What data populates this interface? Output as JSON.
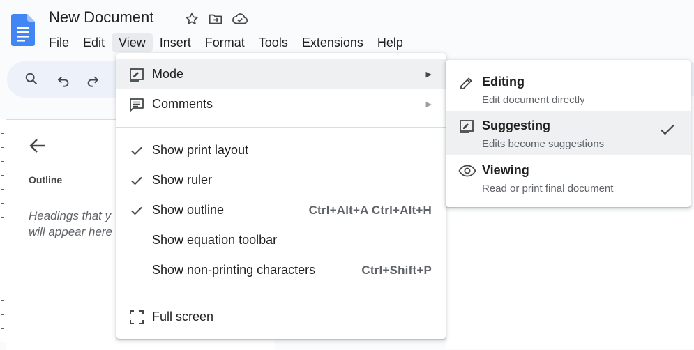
{
  "app": {
    "title": "New Document",
    "title_icons": [
      "star-icon",
      "move-to-folder-icon",
      "cloud-saved-icon"
    ]
  },
  "menubar": {
    "items": [
      "File",
      "Edit",
      "View",
      "Insert",
      "Format",
      "Tools",
      "Extensions",
      "Help"
    ],
    "active": "View"
  },
  "toolbar": {
    "icons": [
      "search-icon",
      "undo-icon",
      "redo-icon"
    ]
  },
  "outline": {
    "label": "Outline",
    "hint_line1": "Headings that y",
    "hint_line2": "will appear here"
  },
  "view_menu": {
    "mode": {
      "label": "Mode",
      "icon": "mode-icon"
    },
    "comments": {
      "label": "Comments",
      "icon": "comments-icon"
    },
    "print_layout": {
      "label": "Show print layout",
      "checked": true
    },
    "ruler": {
      "label": "Show ruler",
      "checked": true
    },
    "outline": {
      "label": "Show outline",
      "checked": true,
      "shortcut": "Ctrl+Alt+A Ctrl+Alt+H"
    },
    "equation": {
      "label": "Show equation toolbar",
      "checked": false
    },
    "nonprinting": {
      "label": "Show non-printing characters",
      "checked": false,
      "shortcut": "Ctrl+Shift+P"
    },
    "fullscreen": {
      "label": "Full screen",
      "icon": "fullscreen-icon"
    }
  },
  "mode_submenu": {
    "editing": {
      "title": "Editing",
      "desc": "Edit document directly"
    },
    "suggesting": {
      "title": "Suggesting",
      "desc": "Edits become suggestions",
      "selected": true
    },
    "viewing": {
      "title": "Viewing",
      "desc": "Read or print final document"
    }
  },
  "colors": {
    "doc_blue": "#4285f4",
    "menu_hover": "#eef0f2",
    "toolbar_bg": "#edf2fa"
  }
}
